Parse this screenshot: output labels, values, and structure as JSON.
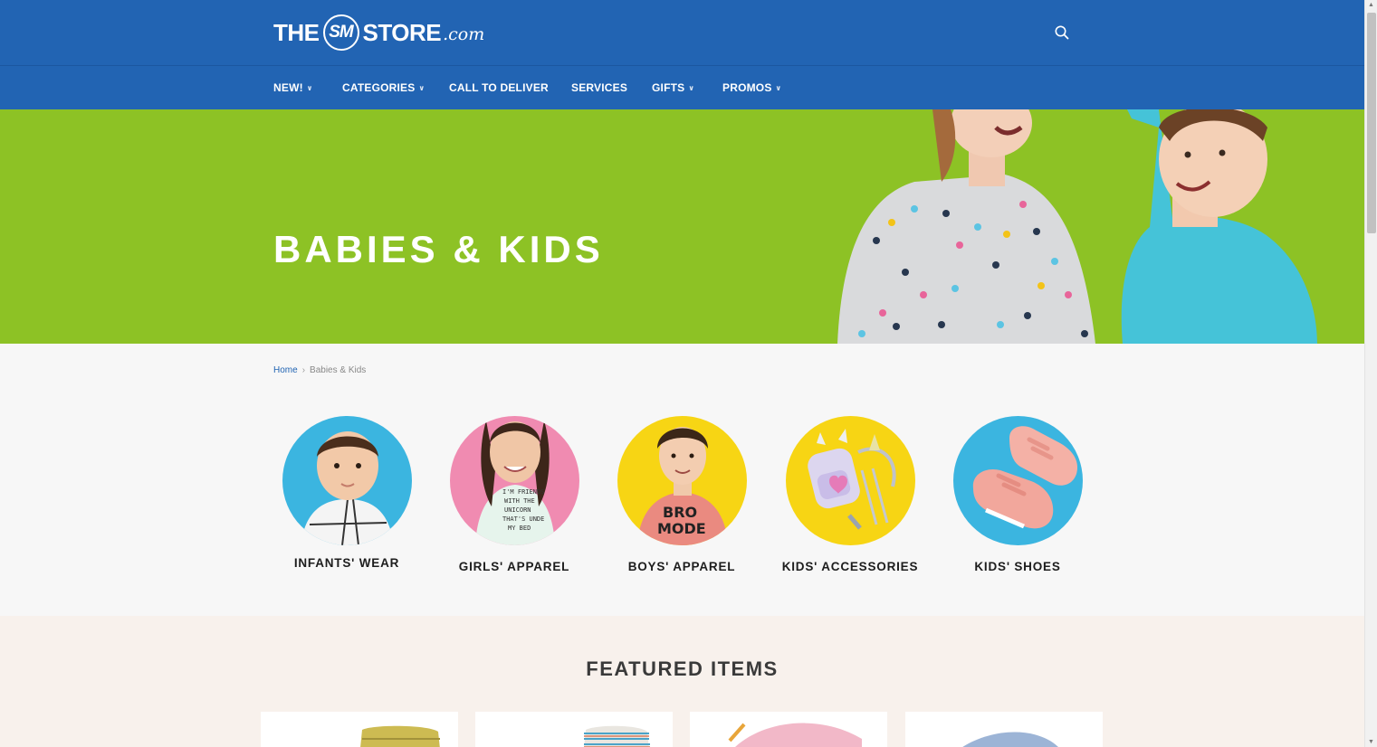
{
  "brand": {
    "the": "THE",
    "sm": "SM",
    "store": "STORE",
    "com": ".com"
  },
  "header": {
    "search_icon": "search-icon"
  },
  "nav": [
    {
      "label": "NEW!",
      "has_dropdown": true
    },
    {
      "label": "CATEGORIES",
      "has_dropdown": true
    },
    {
      "label": "CALL TO DELIVER",
      "has_dropdown": false
    },
    {
      "label": "SERVICES",
      "has_dropdown": false
    },
    {
      "label": "GIFTS",
      "has_dropdown": true
    },
    {
      "label": "PROMOS",
      "has_dropdown": true
    }
  ],
  "hero": {
    "title": "BABIES & KIDS"
  },
  "breadcrumb": {
    "home": "Home",
    "separator": "›",
    "current": "Babies & Kids"
  },
  "categories": [
    {
      "label": "INFANTS' WEAR",
      "bg": "#3bb5e0"
    },
    {
      "label": "GIRLS' APPAREL",
      "bg": "#f08bb1"
    },
    {
      "label": "BOYS' APPAREL",
      "bg": "#f7d514"
    },
    {
      "label": "KIDS' ACCESSORIES",
      "bg": "#f7d514"
    },
    {
      "label": "KIDS' SHOES",
      "bg": "#3bb5e0"
    }
  ],
  "featured": {
    "title": "FEATURED ITEMS"
  },
  "colors": {
    "header": "#2264b3",
    "hero": "#8dc225",
    "featured_bg": "#f8f1ec",
    "page_bg": "#f7f7f7"
  }
}
